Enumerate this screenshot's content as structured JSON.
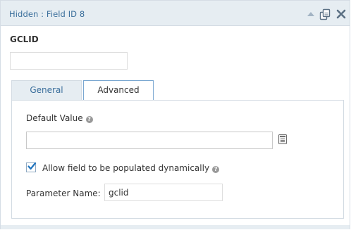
{
  "header": {
    "title": "Hidden : Field ID 8",
    "icons": [
      "collapse-arrow-icon",
      "duplicate-icon",
      "delete-icon"
    ]
  },
  "field": {
    "label": "GCLID",
    "preview_value": ""
  },
  "tabs": [
    {
      "label": "General",
      "active": false
    },
    {
      "label": "Advanced",
      "active": true
    }
  ],
  "advanced": {
    "default_value_label": "Default Value",
    "default_value": "",
    "dynamic_population_label": "Allow field to be populated dynamically",
    "dynamic_population_checked": true,
    "parameter_name_label": "Parameter Name:",
    "parameter_name_value": "gclid"
  },
  "colors": {
    "header_bg": "#e6edf2",
    "title_text": "#3b6f9c",
    "active_tab_border": "#7aa7d1",
    "checkbox_check": "#1e73be"
  }
}
